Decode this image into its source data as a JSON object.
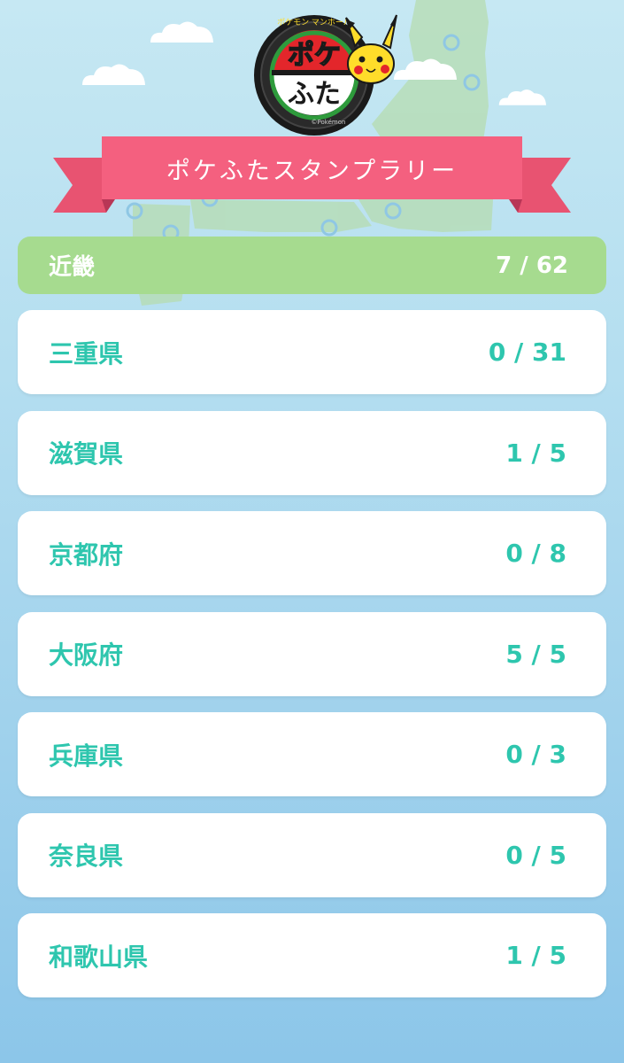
{
  "header": {
    "title": "ポケふたスタンプラリー",
    "logo_text": "ポケふた",
    "logo_arc_text": "ポケモン マンホール",
    "logo_copyright": "©Pokémon"
  },
  "region": {
    "name": "近畿",
    "progress": "7 / 62"
  },
  "prefectures": [
    {
      "name": "三重県",
      "progress": "0 / 31"
    },
    {
      "name": "滋賀県",
      "progress": "1 / 5"
    },
    {
      "name": "京都府",
      "progress": "0 / 8"
    },
    {
      "name": "大阪府",
      "progress": "5 / 5"
    },
    {
      "name": "兵庫県",
      "progress": "0 / 3"
    },
    {
      "name": "奈良県",
      "progress": "0 / 5"
    },
    {
      "name": "和歌山県",
      "progress": "1 / 5"
    }
  ],
  "colors": {
    "accent_text": "#2ec6ae",
    "region_bar": "#a6db8f",
    "banner": "#f4607f",
    "background": "#b4def0"
  }
}
